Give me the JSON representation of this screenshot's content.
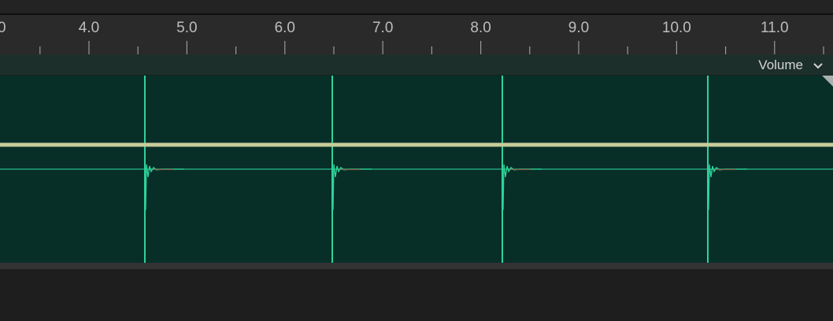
{
  "ruler": {
    "labels": [
      {
        "text": "4.0",
        "value": 4.0
      },
      {
        "text": "5.0",
        "value": 5.0
      },
      {
        "text": "6.0",
        "value": 6.0
      },
      {
        "text": "7.0",
        "value": 7.0
      },
      {
        "text": "8.0",
        "value": 8.0
      },
      {
        "text": "9.0",
        "value": 9.0
      },
      {
        "text": "10.0",
        "value": 10.0
      },
      {
        "text": "11.0",
        "value": 11.0
      }
    ],
    "partial_left_label": "0"
  },
  "track": {
    "envelope_label": "Volume",
    "envelope_icon": "chevron-down-icon",
    "clip_color": "#082e28",
    "waveform_color": "#2fd39a",
    "volume_line_color": "#c8cc9a"
  },
  "clicks": [
    4.57,
    6.48,
    8.22,
    10.32
  ]
}
